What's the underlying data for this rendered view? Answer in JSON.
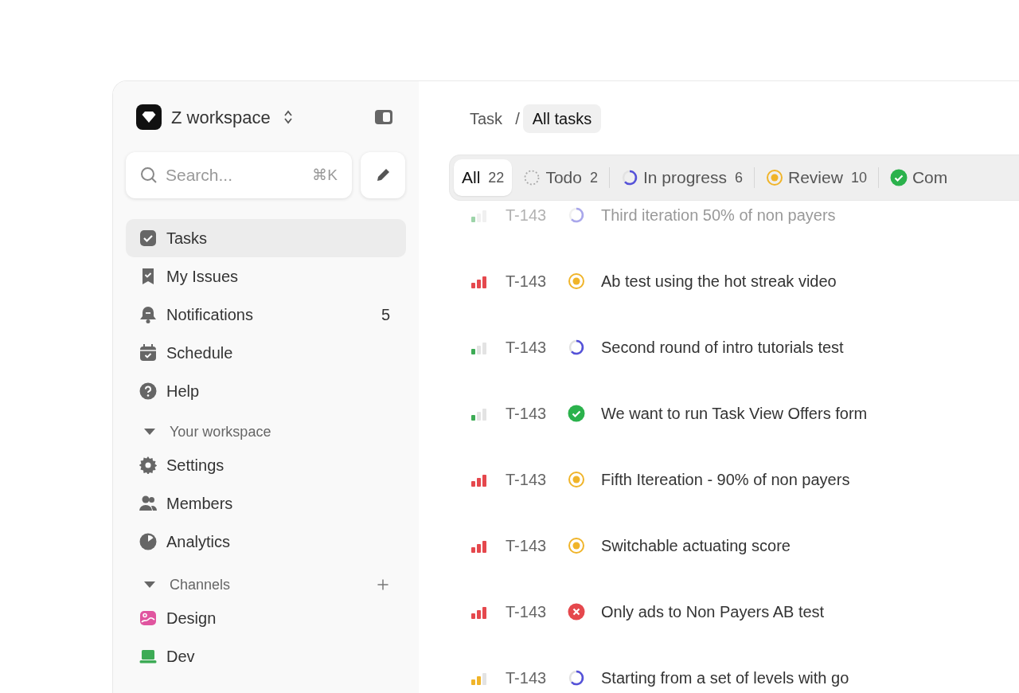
{
  "workspace": {
    "name": "Z workspace"
  },
  "search": {
    "placeholder": "Search...",
    "shortcut": "⌘K"
  },
  "nav": [
    {
      "label": "Tasks",
      "selected": true
    },
    {
      "label": "My Issues",
      "selected": false
    },
    {
      "label": "Notifications",
      "selected": false,
      "badge": "5"
    },
    {
      "label": "Schedule",
      "selected": false
    },
    {
      "label": "Help",
      "selected": false
    }
  ],
  "sections": [
    {
      "title": "Your workspace",
      "expanded": true,
      "items": [
        {
          "label": "Settings",
          "selected": false
        },
        {
          "label": "Members",
          "selected": false
        },
        {
          "label": "Analytics",
          "selected": false
        }
      ]
    },
    {
      "title": "Channels",
      "expanded": true,
      "can_add": true,
      "items": [
        {
          "label": "Design",
          "selected": false,
          "color": "#e0559f"
        },
        {
          "label": "Dev",
          "selected": false,
          "color": "#3dab55"
        }
      ]
    }
  ],
  "breadcrumb": {
    "separator": "/",
    "items": [
      {
        "label": "Task",
        "selected": false
      },
      {
        "label": "All tasks",
        "selected": true
      }
    ]
  },
  "filters": [
    {
      "label": "All",
      "count": "22",
      "selected": true
    },
    {
      "label": "Todo",
      "count": "2",
      "icon": {
        "kind": "todo"
      },
      "selected": false
    },
    {
      "label": "In progress",
      "count": "6",
      "icon": {
        "kind": "progress"
      },
      "selected": false
    },
    {
      "label": "Review",
      "count": "10",
      "icon": {
        "kind": "review"
      },
      "selected": false
    },
    {
      "label": "Com",
      "icon": {
        "kind": "done"
      },
      "selected": false
    }
  ],
  "tasks": [
    {
      "priority": {
        "kind": "low"
      },
      "id": "T-143",
      "status": {
        "kind": "progress"
      },
      "title": "Third iteration 50% of non payers",
      "faded": true
    },
    {
      "priority": {
        "kind": "high"
      },
      "id": "T-143",
      "status": {
        "kind": "review"
      },
      "title": "Ab test using the hot streak video",
      "faded": false
    },
    {
      "priority": {
        "kind": "low"
      },
      "id": "T-143",
      "status": {
        "kind": "progress"
      },
      "title": "Second round of intro tutorials test",
      "faded": false
    },
    {
      "priority": {
        "kind": "low"
      },
      "id": "T-143",
      "status": {
        "kind": "done"
      },
      "title": "We want to run Task View Offers form",
      "faded": false
    },
    {
      "priority": {
        "kind": "high"
      },
      "id": "T-143",
      "status": {
        "kind": "review"
      },
      "title": "Fifth Itereation - 90% of non payers",
      "faded": false
    },
    {
      "priority": {
        "kind": "high"
      },
      "id": "T-143",
      "status": {
        "kind": "review"
      },
      "title": "Switchable actuating score",
      "faded": false
    },
    {
      "priority": {
        "kind": "high"
      },
      "id": "T-143",
      "status": {
        "kind": "cancelled"
      },
      "title": "Only ads to Non Payers AB test",
      "faded": false
    },
    {
      "priority": {
        "kind": "medium"
      },
      "id": "T-143",
      "status": {
        "kind": "progress"
      },
      "title": "Starting from a set of levels with go",
      "faded": false
    }
  ]
}
